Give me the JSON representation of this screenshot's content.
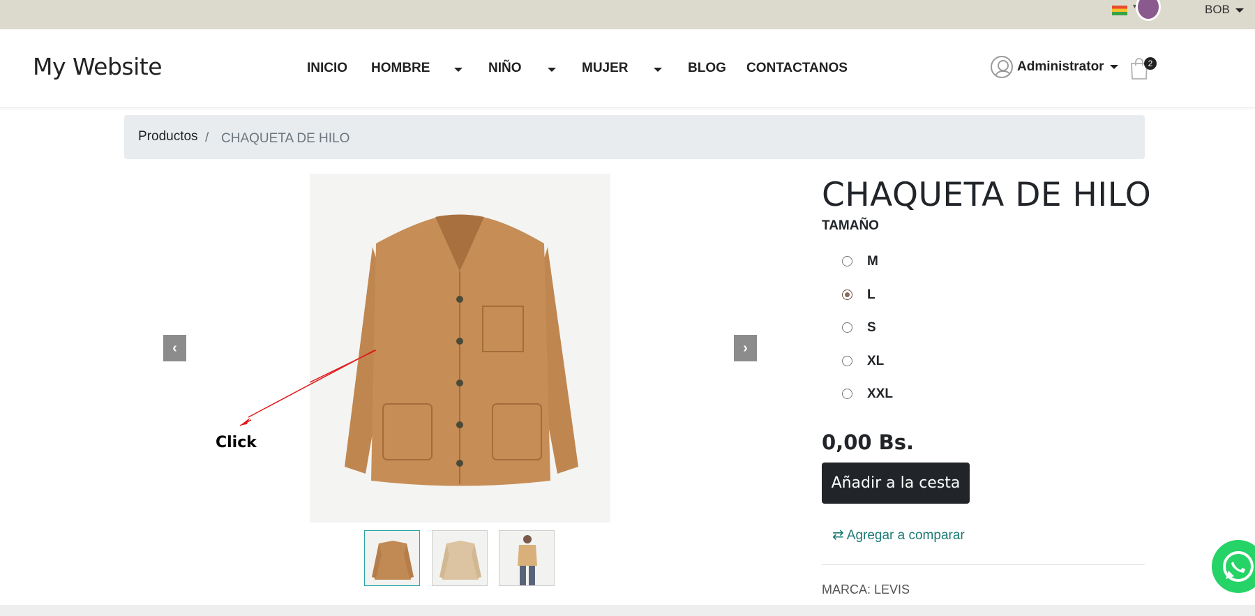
{
  "topbar": {
    "currency": "BOB"
  },
  "header": {
    "brand": "My Website",
    "nav": [
      {
        "label": "INICIO"
      },
      {
        "label": "HOMBRE"
      },
      {
        "label": "NIÑO"
      },
      {
        "label": "MUJER"
      },
      {
        "label": "BLOG"
      },
      {
        "label": "CONTACTANOS"
      }
    ],
    "user": "Administrator",
    "cart_count": "2"
  },
  "breadcrumb": {
    "parent": "Productos",
    "separator": "/",
    "current": "CHAQUETA DE HILO"
  },
  "annotation": {
    "label": "Click",
    "color": "#e01b1b"
  },
  "product": {
    "title": "CHAQUETA DE HILO",
    "attribute_label": "TAMAÑO",
    "sizes": [
      {
        "label": "M",
        "checked": false
      },
      {
        "label": "L",
        "checked": true
      },
      {
        "label": "S",
        "checked": false
      },
      {
        "label": "XL",
        "checked": false
      },
      {
        "label": "XXL",
        "checked": false
      }
    ],
    "price": "0,00 Bs.",
    "add_to_cart": "Añadir a la cesta",
    "compare": "Agregar a comparar",
    "brand_line": "MARCA: LEVIS"
  },
  "colors": {
    "jacket_main": "#c18a55",
    "jacket_light": "#dcc4a2",
    "accent_teal": "#1d7a74",
    "whatsapp": "#25d366"
  }
}
